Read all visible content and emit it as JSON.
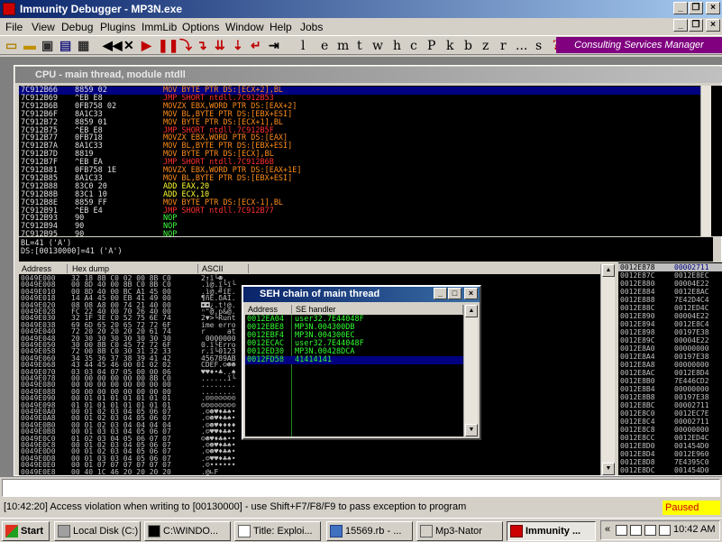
{
  "window": {
    "title": "Immunity Debugger - MP3N.exe"
  },
  "menu": [
    "File",
    "View",
    "Debug",
    "Plugins",
    "ImmLib",
    "Options",
    "Window",
    "Help",
    "Jobs"
  ],
  "toolbar": {
    "letters": [
      "l",
      "e",
      "m",
      "t",
      "w",
      "h",
      "c",
      "P",
      "k",
      "b",
      "z",
      "r",
      "...",
      "s"
    ],
    "question": "?",
    "consulting": "Consulting Services Manager"
  },
  "cpu": {
    "title": "CPU - main thread, module ntdll",
    "disasm": [
      {
        "addr": "7C912B66",
        "hex": "8859 02",
        "instr": "MOV BYTE PTR DS:[ECX+2],BL",
        "kind": "mov",
        "selected": true
      },
      {
        "addr": "7C912B69",
        "hex": "^EB E8",
        "instr": "JMP SHORT ntdll.7C912B53",
        "kind": "jmp"
      },
      {
        "addr": "7C912B6B",
        "hex": "0FB758 02",
        "instr": "MOVZX EBX,WORD PTR DS:[EAX+2]",
        "kind": "mov"
      },
      {
        "addr": "7C912B6F",
        "hex": "8A1C33",
        "instr": "MOV BL,BYTE PTR DS:[EBX+ESI]",
        "kind": "mov"
      },
      {
        "addr": "7C912B72",
        "hex": "8859 01",
        "instr": "MOV BYTE PTR DS:[ECX+1],BL",
        "kind": "mov"
      },
      {
        "addr": "7C912B75",
        "hex": "^EB E8",
        "instr": "JMP SHORT ntdll.7C912B5F",
        "kind": "jmp"
      },
      {
        "addr": "7C912B77",
        "hex": "0FB718",
        "instr": "MOVZX EBX,WORD PTR DS:[EAX]",
        "kind": "mov"
      },
      {
        "addr": "7C912B7A",
        "hex": "8A1C33",
        "instr": "MOV BL,BYTE PTR DS:[EBX+ESI]",
        "kind": "mov"
      },
      {
        "addr": "7C912B7D",
        "hex": "8819",
        "instr": "MOV BYTE PTR DS:[ECX],BL",
        "kind": "mov"
      },
      {
        "addr": "7C912B7F",
        "hex": "^EB EA",
        "instr": "JMP SHORT ntdll.7C912B6B",
        "kind": "jmp"
      },
      {
        "addr": "7C912B81",
        "hex": "0FB758 1E",
        "instr": "MOVZX EBX,WORD PTR DS:[EAX+1E]",
        "kind": "mov"
      },
      {
        "addr": "7C912B85",
        "hex": "8A1C33",
        "instr": "MOV BL,BYTE PTR DS:[EBX+ESI]",
        "kind": "mov"
      },
      {
        "addr": "7C912B88",
        "hex": "83C0 20",
        "instr": "ADD EAX,20",
        "kind": "add"
      },
      {
        "addr": "7C912B8B",
        "hex": "83C1 10",
        "instr": "ADD ECX,10",
        "kind": "add"
      },
      {
        "addr": "7C912B8E",
        "hex": "8859 FF",
        "instr": "MOV BYTE PTR DS:[ECX-1],BL",
        "kind": "mov"
      },
      {
        "addr": "7C912B91",
        "hex": "^EB E4",
        "instr": "JMP SHORT ntdll.7C912B77",
        "kind": "jmp"
      },
      {
        "addr": "7C912B93",
        "hex": "90",
        "instr": "NOP",
        "kind": "nop"
      },
      {
        "addr": "7C912B94",
        "hex": "90",
        "instr": "NOP",
        "kind": "nop"
      },
      {
        "addr": "7C912B95",
        "hex": "90",
        "instr": "NOP",
        "kind": "nop"
      }
    ],
    "info": [
      "BL=41 ('A')",
      "DS:[00130000]=41 ('A')"
    ],
    "dump_headers": [
      "Address",
      "Hex dump",
      "ASCII"
    ],
    "dump": [
      [
        "0049E000",
        "32 18 8B C0 02 00 8B C0",
        "2↑ï└☻."
      ],
      [
        "0049E008",
        "00 8D 40 00 8B C0 8B C0",
        ".ì@.ï└ï└"
      ],
      [
        "0049E010",
        "00 8D 40 00 BC A1 45 00",
        ".ì@.╝íE."
      ],
      [
        "0049E018",
        "14 A4 45 00 EB 41 49 00",
        "¶ñE.δAI."
      ],
      [
        "0049E020",
        "08 08 A8 00 74 21 40 00",
        "◘◘¿.t!@."
      ],
      [
        "0049E028",
        "FC 22 40 00 70 26 40 00",
        "ⁿ\"@.p&@."
      ],
      [
        "0049E030",
        "32 1F 3E C0 52 75 6E 74",
        "2▼>└Runt"
      ],
      [
        "0049E038",
        "69 6D 65 20 65 72 72 6F",
        "ime erro"
      ],
      [
        "0049E040",
        "72 20 20 20 20 20 61 74",
        "r     at"
      ],
      [
        "0049E048",
        "20 30 30 30 30 30 30 30",
        " 0000000"
      ],
      [
        "0049E050",
        "30 00 8B C0 45 72 72 6F",
        "0.ï└Erro"
      ],
      [
        "0049E058",
        "72 00 8B C0 30 31 32 33",
        "r.ï└0123"
      ],
      [
        "0049E060",
        "34 35 36 37 38 39 41 42",
        "456789AB"
      ],
      [
        "0049E068",
        "43 44 45 46 00 01 02 02",
        "CDEF.☺☻☻"
      ],
      [
        "0049E070",
        "03 03 04 07 05 00 00 06",
        "♥♥♦•♣..♠"
      ],
      [
        "0049E078",
        "00 00 00 00 00 00 8B C0",
        "......ï└"
      ],
      [
        "0049E080",
        "00 00 00 00 00 00 00 00",
        "........"
      ],
      [
        "0049E088",
        "00 00 00 00 00 00 00 00",
        "........"
      ],
      [
        "0049E090",
        "00 01 01 01 01 01 01 01",
        ".☺☺☺☺☺☺☺"
      ],
      [
        "0049E098",
        "01 01 01 01 01 01 01 01",
        "☺☺☺☺☺☺☺☺"
      ],
      [
        "0049E0A0",
        "00 01 02 03 04 05 06 07",
        ".☺☻♥♦♣♠•"
      ],
      [
        "0049E0A8",
        "00 01 02 03 04 05 06 07",
        ".☺☻♥♦♣♠•"
      ],
      [
        "0049E0B0",
        "00 01 02 03 04 04 04 04",
        ".☺☻♥♦♦♦♦"
      ],
      [
        "0049E0B8",
        "00 01 03 03 04 05 06 07",
        ".☺♥♥♦♣♠•"
      ],
      [
        "0049E0C0",
        "01 02 03 04 05 06 07 07",
        "☺☻♥♦♣♠••"
      ],
      [
        "0049E0C8",
        "00 01 02 03 04 05 06 07",
        ".☺☻♥♦♣♠•"
      ],
      [
        "0049E0D0",
        "00 01 02 03 04 05 06 07",
        ".☺☻♥♦♣♠•"
      ],
      [
        "0049E0D8",
        "00 01 03 03 04 05 06 07",
        ".☺♥♥♦♣♠•"
      ],
      [
        "0049E0E0",
        "00 01 07 07 07 07 07 07",
        ".☺••••••"
      ],
      [
        "0049E0E8",
        "00 40 1C 46 20 20 20 20",
        ".@∟F    "
      ]
    ],
    "stack": [
      [
        "0012E878",
        "00002711"
      ],
      [
        "0012E87C",
        "0012E8EC"
      ],
      [
        "0012E880",
        "00004E22"
      ],
      [
        "0012E884",
        "0012E8AC"
      ],
      [
        "0012E888",
        "7E42D4C4"
      ],
      [
        "0012E88C",
        "0012ED4C"
      ],
      [
        "0012E890",
        "00004E22"
      ],
      [
        "0012E894",
        "0012E8C4"
      ],
      [
        "0012E898",
        "00197E38"
      ],
      [
        "0012E89C",
        "00004E22"
      ],
      [
        "0012E8A0",
        "00000000"
      ],
      [
        "0012E8A4",
        "00197E38"
      ],
      [
        "0012E8A8",
        "00000000"
      ],
      [
        "0012E8AC",
        "0012E8D4"
      ],
      [
        "0012E8B0",
        "7E446CD2"
      ],
      [
        "0012E8B4",
        "00000000"
      ],
      [
        "0012E8B8",
        "00197E38"
      ],
      [
        "0012E8BC",
        "00002711"
      ],
      [
        "0012E8C0",
        "0012EC7E"
      ],
      [
        "0012E8C4",
        "00002711"
      ],
      [
        "0012E8C8",
        "00000000"
      ],
      [
        "0012E8CC",
        "0012ED4C"
      ],
      [
        "0012E8D0",
        "001454D0"
      ],
      [
        "0012E8D4",
        "0012E960"
      ],
      [
        "0012E8D8",
        "7E4395C0"
      ],
      [
        "0012E8DC",
        "001454D0"
      ]
    ]
  },
  "seh": {
    "title": "SEH chain of main thread",
    "headers": [
      "Address",
      "SE handler"
    ],
    "rows": [
      [
        "0012EA04",
        "user32.7E44048F"
      ],
      [
        "0012EBE8",
        "MP3N.004300DB"
      ],
      [
        "0012EBF4",
        "MP3N.004300EC"
      ],
      [
        "0012ECAC",
        "user32.7E44048F"
      ],
      [
        "0012ED30",
        "MP3N.00428DCA"
      ],
      [
        "0012FD58",
        "41414141"
      ]
    ]
  },
  "status": {
    "message": "[10:42:20] Access violation when writing to [00130000] - use Shift+F7/F8/F9 to pass exception to program",
    "state": "Paused"
  },
  "taskbar": {
    "start": "Start",
    "tasks": [
      "Local Disk (C:)",
      "C:\\WINDO...",
      "Title: Exploi...",
      "15569.rb - ...",
      "Mp3-Nator",
      "Immunity ..."
    ],
    "clock": "10:42 AM"
  }
}
